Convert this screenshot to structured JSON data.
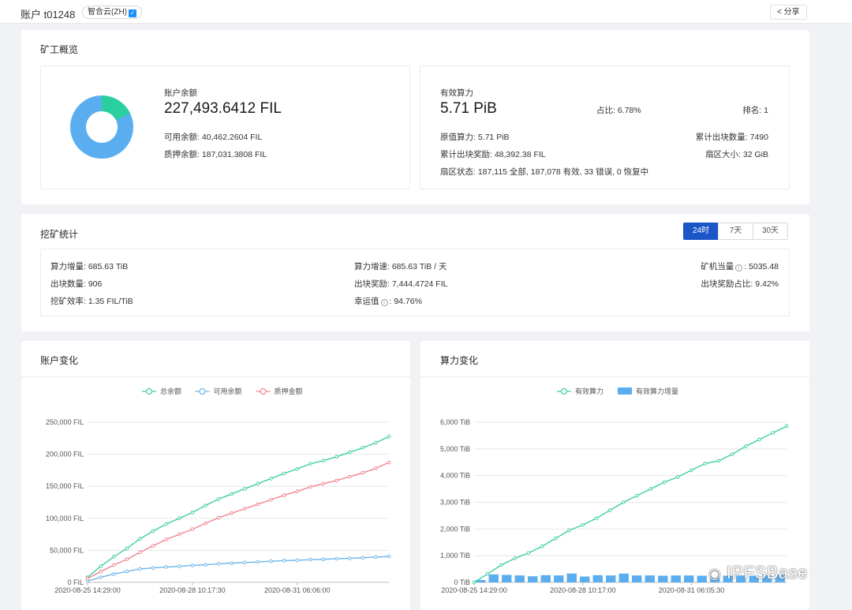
{
  "header": {
    "account_label": "账户 t01248",
    "tag": "智合云(ZH)",
    "share": "分享"
  },
  "overview": {
    "title": "矿工概览",
    "balance": {
      "label": "账户余额",
      "value": "227,493.6412 FIL",
      "available": "可用余额: 40,462.2604 FIL",
      "pledged": "质押余额: 187,031.3808 FIL",
      "donut": {
        "available_fraction": 0.178,
        "available_color": "#2bcf9e",
        "pledged_color": "#5aaef0"
      }
    },
    "power": {
      "label": "有效算力",
      "value": "5.71 PiB",
      "ratio": "占比: 6.78%",
      "rank": "排名: 1",
      "raw": "原值算力: 5.71 PiB",
      "blocks_total": "累计出块数量: 7490",
      "rewards_total": "累计出块奖励: 48,392.38 FIL",
      "sector_size": "扇区大小: 32 GiB",
      "sector_status": "扇区状态: 187,115 全部, 187,078 有效, 33 错误, 0 恢复中"
    }
  },
  "mining": {
    "title": "挖矿统计",
    "ranges": [
      "24时",
      "7天",
      "30天"
    ],
    "active_range": "24时",
    "power_increase": "算力增量: 685.63 TiB",
    "blocks": "出块数量: 906",
    "efficiency": "挖矿效率: 1.35 FIL/TiB",
    "power_speed": "算力增速: 685.63 TiB / 天",
    "block_reward": "出块奖励: 7,444.4724 FIL",
    "luck_label": "幸运值",
    "luck_value": ": 94.76%",
    "equivalent_label": "矿机当量",
    "equivalent_value": ": 5035.48",
    "reward_ratio": "出块奖励占比: 9.42%"
  },
  "watermark": "IPFSBase",
  "chart_data": [
    {
      "type": "line",
      "title": "账户变化",
      "x": [
        "2020-08-25 14:29:00",
        "2020-08-28 10:17:30",
        "2020-08-31 06:06:00"
      ],
      "x_count": 24,
      "yticks": [
        "0 FIL",
        "50,000 FIL",
        "100,000 FIL",
        "150,000 FIL",
        "200,000 FIL",
        "250,000 FIL"
      ],
      "ylim": [
        0,
        250000
      ],
      "series": [
        {
          "name": "总余额",
          "color": "#3ecfa0",
          "values": [
            8000,
            25000,
            40000,
            53000,
            68000,
            80000,
            91000,
            100000,
            109000,
            120000,
            130000,
            138000,
            146000,
            154000,
            162000,
            170000,
            177000,
            185000,
            190000,
            196000,
            203000,
            210000,
            218000,
            227494
          ]
        },
        {
          "name": "可用余额",
          "color": "#6cb4ea",
          "values": [
            2000,
            8000,
            13000,
            17000,
            21000,
            22500,
            24000,
            25000,
            26500,
            27500,
            29000,
            30000,
            31000,
            32000,
            33000,
            34000,
            34500,
            35500,
            36000,
            37000,
            37500,
            38500,
            39500,
            40462
          ]
        },
        {
          "name": "质押金额",
          "color": "#f0848c",
          "values": [
            6000,
            17000,
            27000,
            36000,
            47000,
            57000,
            67000,
            75000,
            83000,
            92000,
            101000,
            108000,
            115000,
            122000,
            129000,
            136000,
            142000,
            149000,
            154000,
            159000,
            165000,
            171000,
            178000,
            187031
          ]
        }
      ]
    },
    {
      "type": "bar+line",
      "title": "算力变化",
      "x": [
        "2020-08-25 14:29:00",
        "2020-08-28 10:17:00",
        "2020-08-31 06:05:30"
      ],
      "x_count": 24,
      "yticks": [
        "0 TiB",
        "1,000 TiB",
        "2,000 TiB",
        "3,000 TiB",
        "4,000 TiB",
        "5,000 TiB",
        "6,000 TiB"
      ],
      "ylim": [
        0,
        6000
      ],
      "series": [
        {
          "name": "有效算力",
          "kind": "line",
          "color": "#3ecfa0",
          "values": [
            0,
            320,
            650,
            900,
            1100,
            1350,
            1650,
            1950,
            2150,
            2400,
            2700,
            3000,
            3250,
            3500,
            3750,
            3950,
            4200,
            4450,
            4550,
            4800,
            5100,
            5350,
            5600,
            5850
          ]
        },
        {
          "name": "有效算力增量",
          "kind": "bar",
          "color": "#5aaef0",
          "values": [
            90,
            300,
            280,
            260,
            230,
            270,
            260,
            330,
            220,
            270,
            260,
            330,
            260,
            260,
            250,
            260,
            260,
            250,
            240,
            250,
            260,
            250,
            260,
            280
          ]
        }
      ]
    }
  ]
}
